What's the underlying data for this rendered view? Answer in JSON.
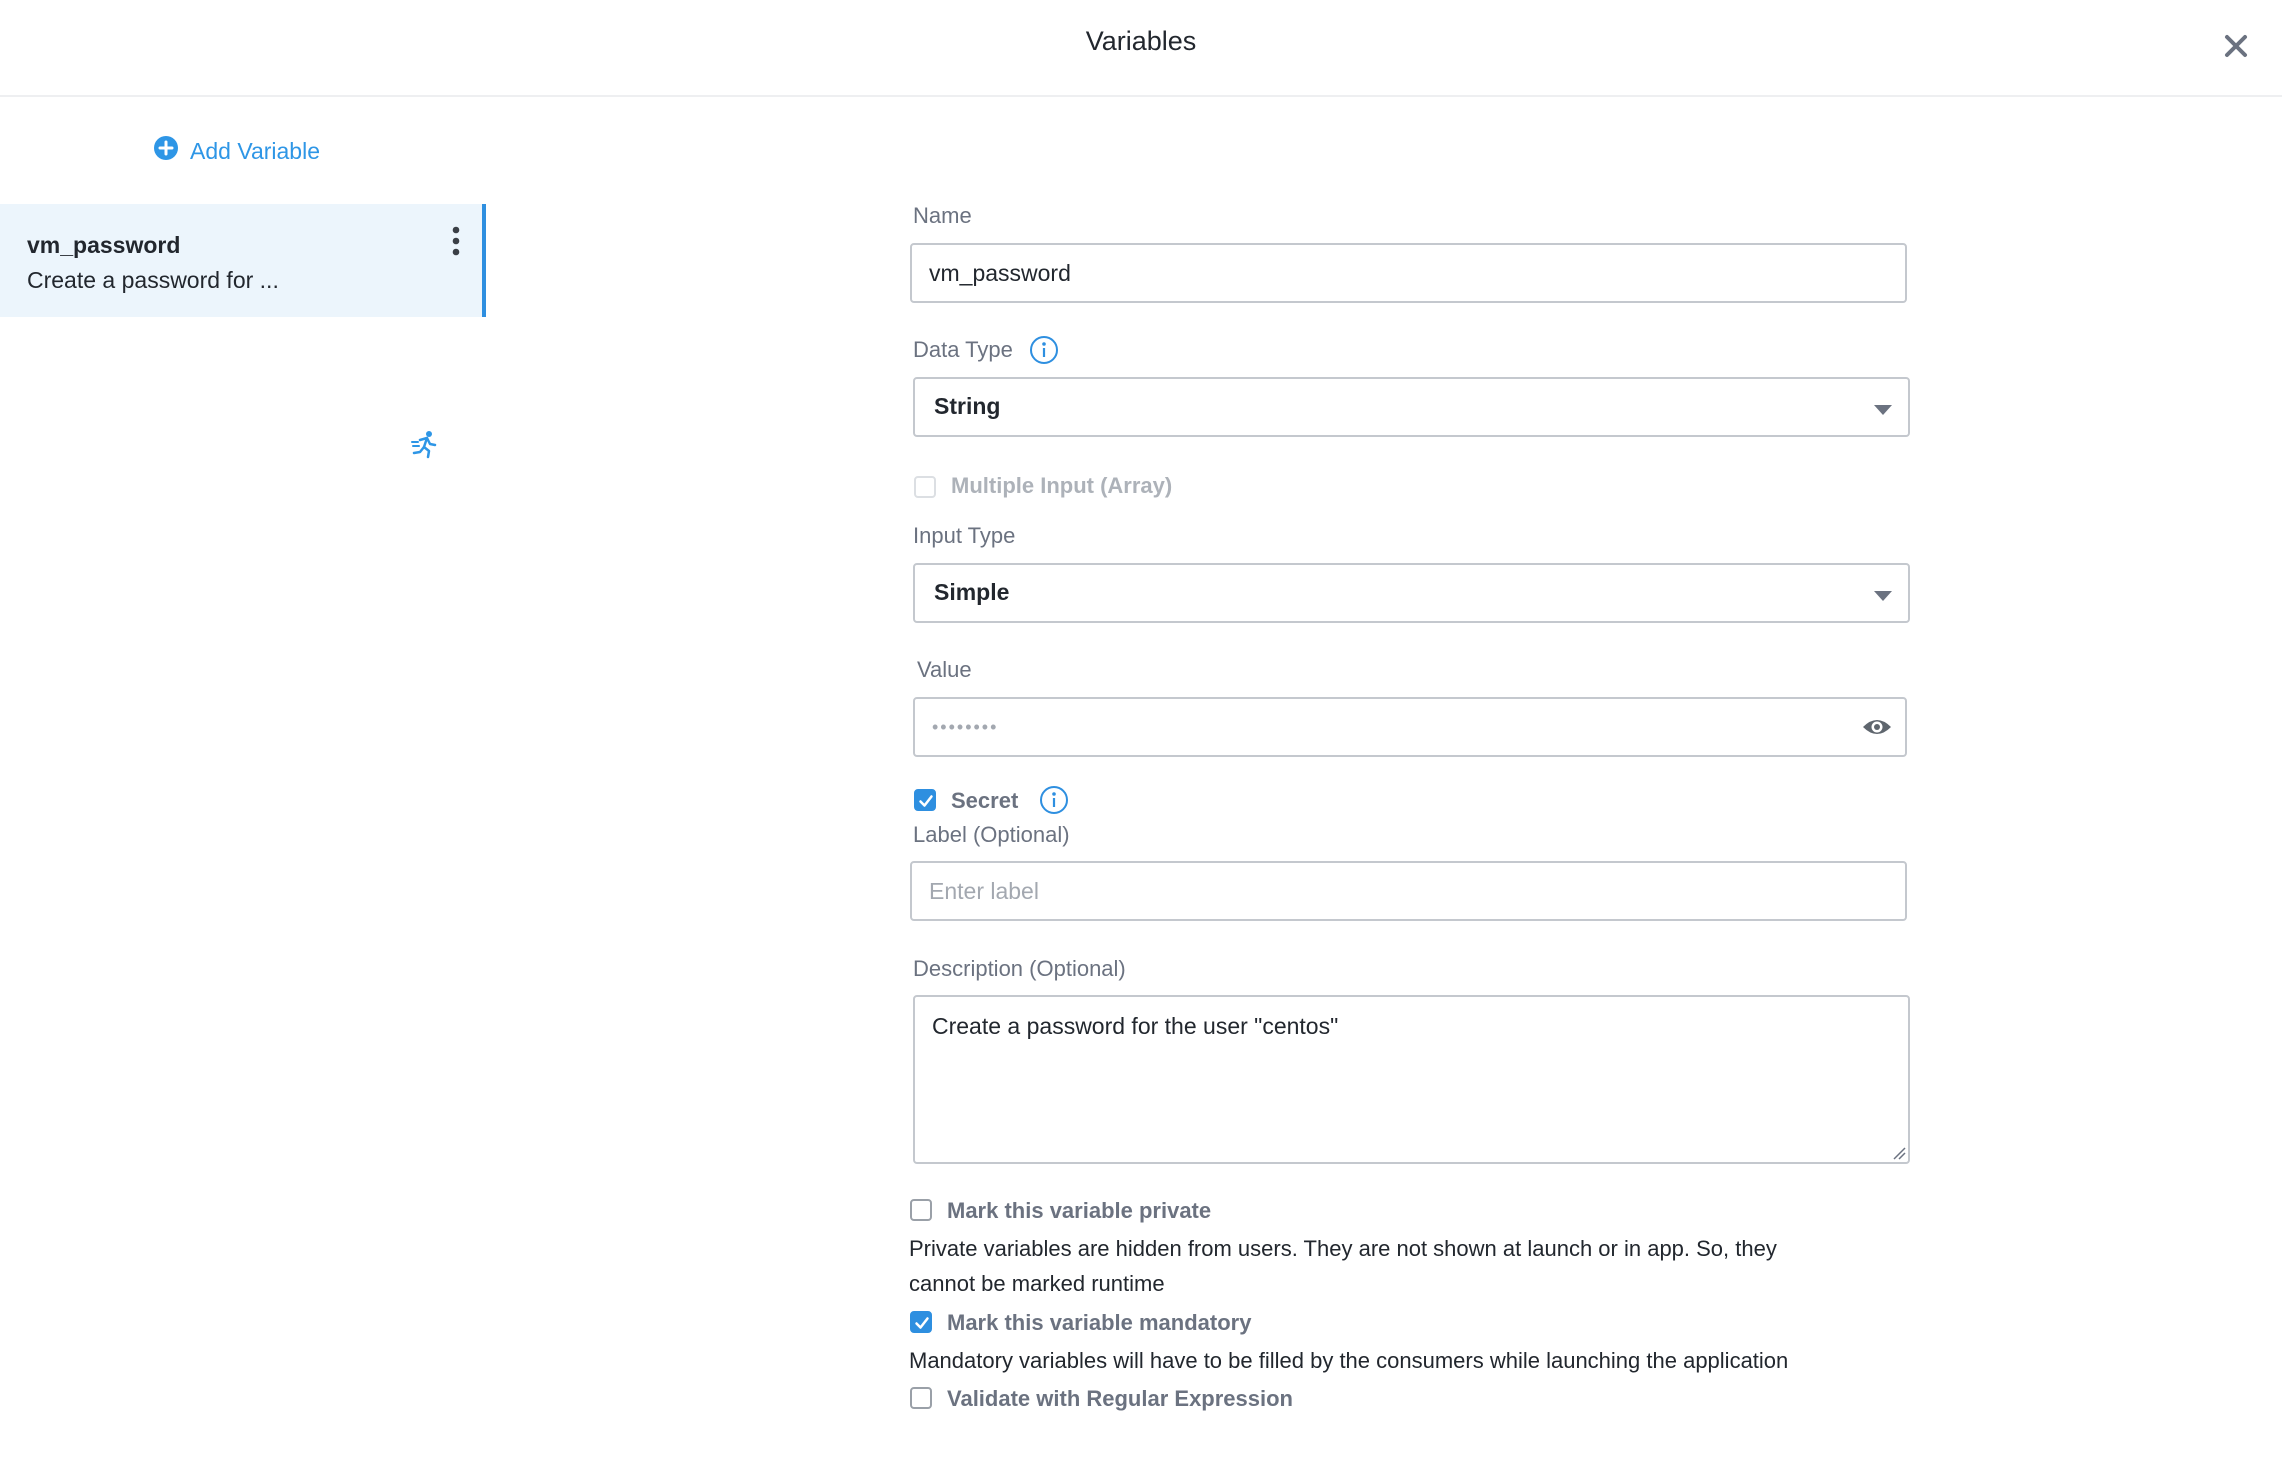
{
  "header": {
    "title": "Variables",
    "close_icon": "close-icon"
  },
  "sidebar": {
    "add_label": "Add Variable",
    "add_icon": "plus-circle-icon",
    "items": [
      {
        "name": "vm_password",
        "description": "Create a password for ...",
        "runtime_icon": "runner-icon",
        "menu_icon": "kebab-menu-icon"
      }
    ]
  },
  "form": {
    "name": {
      "label": "Name",
      "value": "vm_password"
    },
    "data_type": {
      "label": "Data Type",
      "value": "String",
      "info_icon": "info-icon"
    },
    "multiple_input": {
      "label": "Multiple Input (Array)",
      "checked": false,
      "disabled": true
    },
    "input_type": {
      "label": "Input Type",
      "value": "Simple"
    },
    "value": {
      "label": "Value",
      "value": "••••••••",
      "reveal_icon": "eye-icon"
    },
    "secret": {
      "label": "Secret",
      "checked": true,
      "info_icon": "info-icon"
    },
    "label_field": {
      "label": "Label (Optional)",
      "placeholder": "Enter label"
    },
    "description": {
      "label": "Description (Optional)",
      "value": "Create a password for the user \"centos\""
    },
    "private": {
      "label": "Mark this variable private",
      "checked": false,
      "help_line1": "Private variables are hidden from users. They are not shown at launch or in app. So, they",
      "help_line2": "cannot be marked runtime"
    },
    "mandatory": {
      "label": "Mark this variable mandatory",
      "checked": true,
      "help": "Mandatory variables will have to be filled by the consumers while launching the application"
    },
    "regex": {
      "label": "Validate with Regular Expression",
      "checked": false
    }
  },
  "colors": {
    "accent": "#2e8fe0",
    "selected_bg": "#ecf5fc",
    "muted_text": "#6b7280",
    "border": "#c4c8ce"
  }
}
